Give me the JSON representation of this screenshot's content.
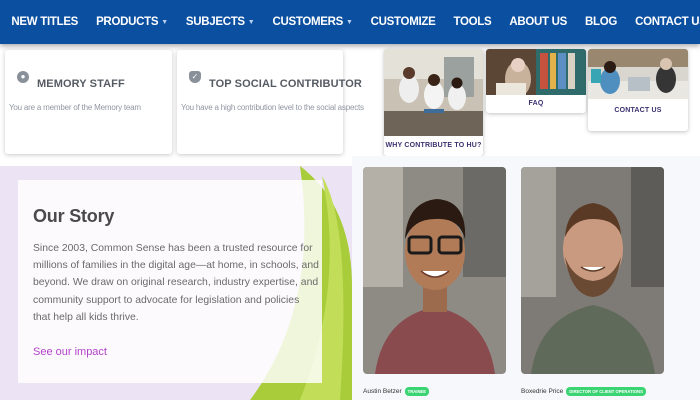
{
  "nav": {
    "items": [
      {
        "label": "NEW TITLES",
        "dropdown": false
      },
      {
        "label": "PRODUCTS",
        "dropdown": true
      },
      {
        "label": "SUBJECTS",
        "dropdown": true
      },
      {
        "label": "CUSTOMERS",
        "dropdown": true
      },
      {
        "label": "CUSTOMIZE",
        "dropdown": false
      },
      {
        "label": "TOOLS",
        "dropdown": false
      },
      {
        "label": "ABOUT US",
        "dropdown": false
      },
      {
        "label": "BLOG",
        "dropdown": false
      },
      {
        "label": "CONTACT US",
        "dropdown": false
      }
    ],
    "bg_color": "#0b4fa0"
  },
  "badges": [
    {
      "title": "MEMORY STAFF",
      "description": "You are a member of the Memory team",
      "icon": "memory-badge-icon"
    },
    {
      "title": "TOP SOCIAL CONTRIBUTOR",
      "description": "You have a high contribution level to the social aspects",
      "icon": "check-shield-icon"
    }
  ],
  "tiles": [
    {
      "label": "WHY CONTRIBUTE TO HU?"
    },
    {
      "label": "FAQ"
    },
    {
      "label": "CONTACT US"
    }
  ],
  "story": {
    "title": "Our Story",
    "body": "Since 2003, Common Sense has been a trusted resource for millions of families in the digital age—at home, in schools, and beyond. We draw on original research, industry expertise, and community support to advocate for legislation and policies that help all kids thrive.",
    "link": "See our impact",
    "link_color": "#b142c9"
  },
  "people": [
    {
      "name": "Austin Betzer",
      "tag": "TRAINEE"
    },
    {
      "name": "Boxedrie Price",
      "tag": "DIRECTOR OF CLIENT OPERATIONS"
    }
  ]
}
